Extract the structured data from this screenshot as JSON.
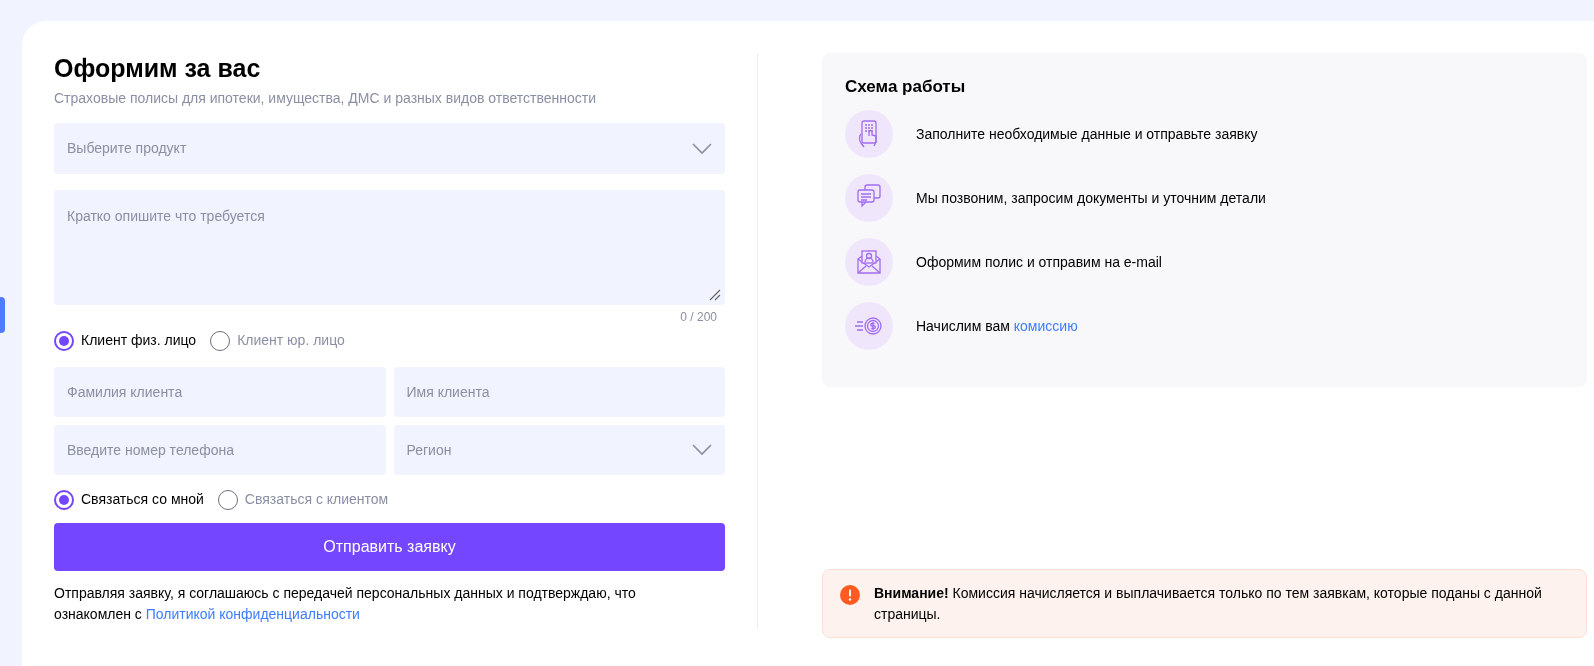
{
  "form": {
    "title": "Оформим за вас",
    "subtitle": "Страховые полисы для ипотеки, имущества, ДМС и разных видов ответственности",
    "product_select": {
      "placeholder": "Выберите продукт"
    },
    "description": {
      "placeholder": "Кратко опишите что требуется",
      "counter": "0 / 200"
    },
    "client_type": [
      {
        "label": "Клиент физ. лицо",
        "selected": true
      },
      {
        "label": "Клиент юр. лицо",
        "selected": false
      }
    ],
    "fields": [
      {
        "kind": "input",
        "placeholder": "Фамилия клиента"
      },
      {
        "kind": "input",
        "placeholder": "Имя клиента"
      },
      {
        "kind": "input",
        "placeholder": "Введите номер телефона"
      },
      {
        "kind": "select",
        "placeholder": "Регион"
      }
    ],
    "contact": [
      {
        "label": "Связаться со мной",
        "selected": true
      },
      {
        "label": "Связаться с клиентом",
        "selected": false
      }
    ],
    "submit": "Отправить заявку",
    "consent": {
      "text": "Отправляя заявку, я соглашаюсь с передачей персональных данных и подтверждаю, что ознакомлен с",
      "link": "Политикой конфиденциальности"
    }
  },
  "scheme": {
    "title": "Схема работы",
    "steps": [
      {
        "kind": "phone",
        "text": "Заполните необходимые данные и отправьте заявку"
      },
      {
        "kind": "chat",
        "text": "Мы позвоним, запросим документы и уточним детали"
      },
      {
        "kind": "mail",
        "text": "Оформим полис и отправим на e-mail"
      },
      {
        "kind": "coin",
        "text": "Начислим вам",
        "link": "комиссию"
      }
    ]
  },
  "notice": {
    "text": "**Внимание!** Комиссия начисляется и выплачивается только по тем заявкам, которые поданы с данной страницы."
  }
}
